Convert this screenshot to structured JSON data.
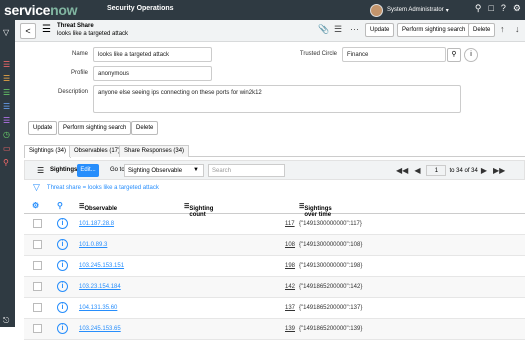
{
  "topbar": {
    "logo": "servicenow",
    "app_name": "Security Operations",
    "user": "System Administrator",
    "user_caret": "▾",
    "icons": [
      "search-icon",
      "chat-icon",
      "help-icon",
      "gear-icon"
    ]
  },
  "header": {
    "title": "Threat Share",
    "subtitle": "looks like a targeted attack",
    "buttons": [
      "Update",
      "Perform sighting search",
      "Delete"
    ],
    "icons": [
      "paperclip-icon",
      "sliders-icon",
      "more-icon",
      "up-arrow-icon",
      "down-arrow-icon"
    ]
  },
  "form": {
    "name_label": "Name",
    "name_value": "looks like a targeted attack",
    "profile_label": "Profile",
    "profile_value": "anonymous",
    "description_label": "Description",
    "description_value": "anyone else seeing ips connecting on these ports for win2k12",
    "trusted_circle_label": "Trusted Circle",
    "trusted_circle_value": "Finance"
  },
  "actions": [
    "Update",
    "Perform sighting search",
    "Delete"
  ],
  "tabs": [
    "Sightings (34)",
    "Observables (17)",
    "Share Responses (34)"
  ],
  "list": {
    "title": "Sightings",
    "edit_label": "Edit...",
    "goto_label": "Go to",
    "goto_select": "Sighting Observable",
    "search_placeholder": "Search",
    "page_value": "1",
    "page_text": "to 34 of 34",
    "breadcrumb": "Threat share = looks like a targeted attack",
    "columns": [
      "Observable",
      "Sighting count",
      "Sightings over time"
    ],
    "rows": [
      {
        "observable": "101.187.28.8",
        "count": "117",
        "over_time": "{\"1491300000000\":117}"
      },
      {
        "observable": "101.0.89.3",
        "count": "108",
        "over_time": "{\"1491300000000\":108}"
      },
      {
        "observable": "103.245.153.151",
        "count": "198",
        "over_time": "{\"1491300000000\":198}"
      },
      {
        "observable": "103.23.154.184",
        "count": "142",
        "over_time": "{\"1491865200000\":142}"
      },
      {
        "observable": "104.131.35.60",
        "count": "137",
        "over_time": "{\"1491865200000\":137}"
      },
      {
        "observable": "103.245.153.65",
        "count": "139",
        "over_time": "{\"1491865200000\":139}"
      }
    ]
  },
  "colors": {
    "topbar": "#2f3a42",
    "accent": "#278efc",
    "logo_accent": "#81b5a1"
  }
}
